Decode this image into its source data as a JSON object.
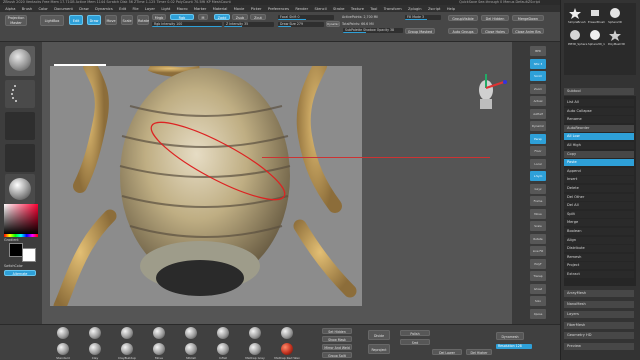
{
  "titlebar": {
    "left": "ZBrush 2020   Ventacks   Free Mem 17.71GB  Active Mem 1144  Scratch Disk 56  ZTime 1.125  Timer 0.02  PolyCount 70.5Mi  KP  MeshCount",
    "right": "QuickSave   See-through 0   Menus   DefaultZScript"
  },
  "menu": [
    "Alpha",
    "Brush",
    "Color",
    "Document",
    "Draw",
    "Dynamics",
    "Edit",
    "File",
    "Layer",
    "Light",
    "Macro",
    "Marker",
    "Material",
    "Movie",
    "Picker",
    "Preferences",
    "Render",
    "Stencil",
    "Stroke",
    "Texture",
    "Tool",
    "Transform",
    "Zplugin",
    "Zscript",
    "Help"
  ],
  "toolbar": {
    "projection_master": "Projection Master",
    "lightbox": "LightBox",
    "edit": "Edit",
    "draw": "Draw",
    "move": "Move",
    "scale": "Scale",
    "rotate": "Rotate",
    "mrgb": "Mrgb",
    "rgb": "Rgb",
    "m": "M",
    "zadd": "Zadd",
    "zsub": "Zsub",
    "zcut": "Zcut",
    "rgb_intensity": "Rgb Intensity 100",
    "z_intensity": "Z Intensity 35",
    "focal_shift": "Focal Shift 0",
    "draw_size": "Draw Size 279",
    "dynamic": "Dynamic",
    "active_points": "ActivePoints: 2,700 Mil",
    "total_points": "TotalPoints: 66.6 Mil",
    "subpalette_shadow": "SubPalette Shadow Opacity 38",
    "fill_mode": "Fill Mode 3",
    "group_visible": "GroupVisible",
    "auto_groups": "Auto Groups",
    "del_hidden": "Del Hidden",
    "close_holes": "Close Holes",
    "merge_visible": "MergeDown",
    "close_anim": "Close Anim Brs",
    "group_masked": "Group Masked"
  },
  "left": {
    "gradient_label": "Gradient",
    "switch_color": "SwitchColor",
    "alternate": "Alternate"
  },
  "right_icons": [
    "BPR",
    "SPix 3",
    "Scroll",
    "Zoom",
    "Actual",
    "AAHalf",
    "Dynamic",
    "Persp",
    "Floor",
    "Local",
    "L.Sym",
    "Gxyz",
    "Frame",
    "Move",
    "Scale",
    "Rotate",
    "Line Fill",
    "PolyF",
    "Transp",
    "Ghost",
    "Solo",
    "Xpose"
  ],
  "tray": {
    "tools": [
      "SimpleBrush",
      "EraserBrush",
      "Sphere3D",
      "PM3D_Sphere",
      "Sphere3D_1",
      "PolyMesh3D"
    ],
    "subtool_header": "Subtool",
    "rows": [
      "List All",
      "Auto Collapse",
      "Rename",
      "AutoReorder",
      "All Low",
      "All High",
      "Copy",
      "Paste",
      "Append",
      "Insert",
      "Delete",
      "Del Other",
      "Del All",
      "Split",
      "Merge",
      "Boolean",
      "Align",
      "Distribute",
      "Remesh",
      "Project",
      "Extract"
    ],
    "bottom_rows": [
      "ArrayMesh",
      "NanoMesh",
      "Layers",
      "FiberMesh",
      "Geometry HD",
      "Preview"
    ]
  },
  "bottom": {
    "brushes_row1": [
      "",
      "",
      "",
      "",
      "",
      "",
      "",
      ""
    ],
    "brushes_row2": [
      "Standard",
      "Clay",
      "ClayBuildup",
      "Move",
      "hPolish",
      "Inflat",
      "MatCap Gray",
      "MatCap Red Wax"
    ],
    "buttons": [
      "Set Hidden",
      "Show Mask",
      "Mirror And Weld",
      "Group Split",
      "Divide",
      "Reproject",
      "Polish",
      "Smt",
      "Dynamesh",
      "Resolution 128",
      "Del Lower",
      "Del Higher"
    ]
  },
  "colors": {
    "accent": "#2ea0d8",
    "panel": "#474747",
    "tray": "#333333"
  }
}
